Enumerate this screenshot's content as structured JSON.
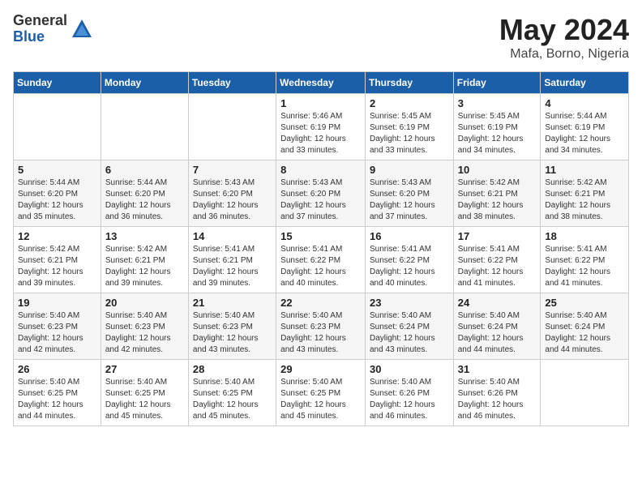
{
  "header": {
    "logo_general": "General",
    "logo_blue": "Blue",
    "title": "May 2024",
    "subtitle": "Mafa, Borno, Nigeria"
  },
  "calendar": {
    "days_of_week": [
      "Sunday",
      "Monday",
      "Tuesday",
      "Wednesday",
      "Thursday",
      "Friday",
      "Saturday"
    ],
    "weeks": [
      [
        {
          "day": "",
          "info": ""
        },
        {
          "day": "",
          "info": ""
        },
        {
          "day": "",
          "info": ""
        },
        {
          "day": "1",
          "info": "Sunrise: 5:46 AM\nSunset: 6:19 PM\nDaylight: 12 hours\nand 33 minutes."
        },
        {
          "day": "2",
          "info": "Sunrise: 5:45 AM\nSunset: 6:19 PM\nDaylight: 12 hours\nand 33 minutes."
        },
        {
          "day": "3",
          "info": "Sunrise: 5:45 AM\nSunset: 6:19 PM\nDaylight: 12 hours\nand 34 minutes."
        },
        {
          "day": "4",
          "info": "Sunrise: 5:44 AM\nSunset: 6:19 PM\nDaylight: 12 hours\nand 34 minutes."
        }
      ],
      [
        {
          "day": "5",
          "info": "Sunrise: 5:44 AM\nSunset: 6:20 PM\nDaylight: 12 hours\nand 35 minutes."
        },
        {
          "day": "6",
          "info": "Sunrise: 5:44 AM\nSunset: 6:20 PM\nDaylight: 12 hours\nand 36 minutes."
        },
        {
          "day": "7",
          "info": "Sunrise: 5:43 AM\nSunset: 6:20 PM\nDaylight: 12 hours\nand 36 minutes."
        },
        {
          "day": "8",
          "info": "Sunrise: 5:43 AM\nSunset: 6:20 PM\nDaylight: 12 hours\nand 37 minutes."
        },
        {
          "day": "9",
          "info": "Sunrise: 5:43 AM\nSunset: 6:20 PM\nDaylight: 12 hours\nand 37 minutes."
        },
        {
          "day": "10",
          "info": "Sunrise: 5:42 AM\nSunset: 6:21 PM\nDaylight: 12 hours\nand 38 minutes."
        },
        {
          "day": "11",
          "info": "Sunrise: 5:42 AM\nSunset: 6:21 PM\nDaylight: 12 hours\nand 38 minutes."
        }
      ],
      [
        {
          "day": "12",
          "info": "Sunrise: 5:42 AM\nSunset: 6:21 PM\nDaylight: 12 hours\nand 39 minutes."
        },
        {
          "day": "13",
          "info": "Sunrise: 5:42 AM\nSunset: 6:21 PM\nDaylight: 12 hours\nand 39 minutes."
        },
        {
          "day": "14",
          "info": "Sunrise: 5:41 AM\nSunset: 6:21 PM\nDaylight: 12 hours\nand 39 minutes."
        },
        {
          "day": "15",
          "info": "Sunrise: 5:41 AM\nSunset: 6:22 PM\nDaylight: 12 hours\nand 40 minutes."
        },
        {
          "day": "16",
          "info": "Sunrise: 5:41 AM\nSunset: 6:22 PM\nDaylight: 12 hours\nand 40 minutes."
        },
        {
          "day": "17",
          "info": "Sunrise: 5:41 AM\nSunset: 6:22 PM\nDaylight: 12 hours\nand 41 minutes."
        },
        {
          "day": "18",
          "info": "Sunrise: 5:41 AM\nSunset: 6:22 PM\nDaylight: 12 hours\nand 41 minutes."
        }
      ],
      [
        {
          "day": "19",
          "info": "Sunrise: 5:40 AM\nSunset: 6:23 PM\nDaylight: 12 hours\nand 42 minutes."
        },
        {
          "day": "20",
          "info": "Sunrise: 5:40 AM\nSunset: 6:23 PM\nDaylight: 12 hours\nand 42 minutes."
        },
        {
          "day": "21",
          "info": "Sunrise: 5:40 AM\nSunset: 6:23 PM\nDaylight: 12 hours\nand 43 minutes."
        },
        {
          "day": "22",
          "info": "Sunrise: 5:40 AM\nSunset: 6:23 PM\nDaylight: 12 hours\nand 43 minutes."
        },
        {
          "day": "23",
          "info": "Sunrise: 5:40 AM\nSunset: 6:24 PM\nDaylight: 12 hours\nand 43 minutes."
        },
        {
          "day": "24",
          "info": "Sunrise: 5:40 AM\nSunset: 6:24 PM\nDaylight: 12 hours\nand 44 minutes."
        },
        {
          "day": "25",
          "info": "Sunrise: 5:40 AM\nSunset: 6:24 PM\nDaylight: 12 hours\nand 44 minutes."
        }
      ],
      [
        {
          "day": "26",
          "info": "Sunrise: 5:40 AM\nSunset: 6:25 PM\nDaylight: 12 hours\nand 44 minutes."
        },
        {
          "day": "27",
          "info": "Sunrise: 5:40 AM\nSunset: 6:25 PM\nDaylight: 12 hours\nand 45 minutes."
        },
        {
          "day": "28",
          "info": "Sunrise: 5:40 AM\nSunset: 6:25 PM\nDaylight: 12 hours\nand 45 minutes."
        },
        {
          "day": "29",
          "info": "Sunrise: 5:40 AM\nSunset: 6:25 PM\nDaylight: 12 hours\nand 45 minutes."
        },
        {
          "day": "30",
          "info": "Sunrise: 5:40 AM\nSunset: 6:26 PM\nDaylight: 12 hours\nand 46 minutes."
        },
        {
          "day": "31",
          "info": "Sunrise: 5:40 AM\nSunset: 6:26 PM\nDaylight: 12 hours\nand 46 minutes."
        },
        {
          "day": "",
          "info": ""
        }
      ]
    ]
  }
}
